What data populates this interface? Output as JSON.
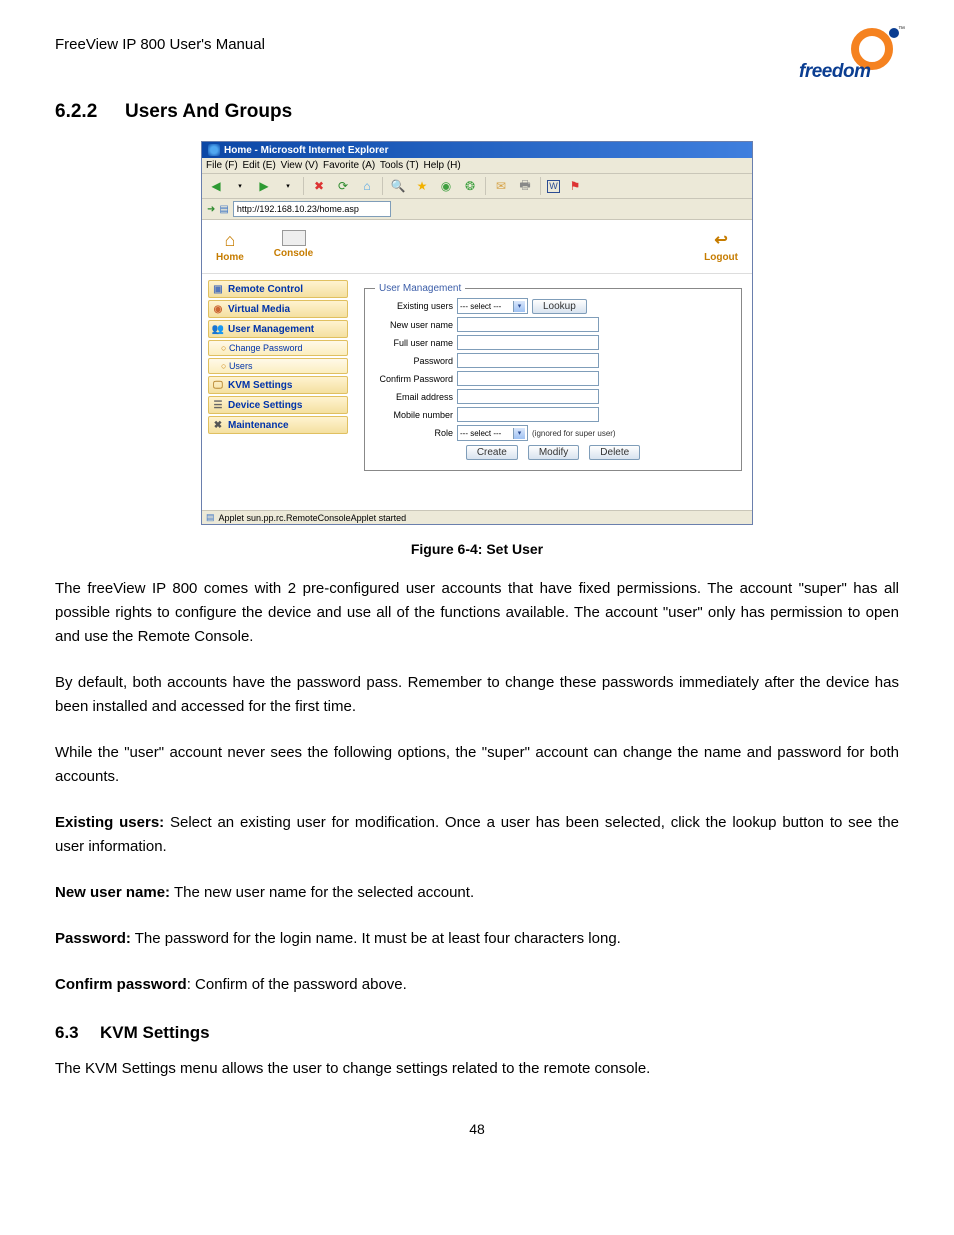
{
  "doc_header": "FreeView IP 800 User's Manual",
  "logo_text": "freedom",
  "section_622_num": "6.2.2",
  "section_622_title": "Users And Groups",
  "window_title": "Home - Microsoft Internet Explorer",
  "menus": [
    "File (F)",
    "Edit (E)",
    "View (V)",
    "Favorite (A)",
    "Tools (T)",
    "Help (H)"
  ],
  "address_url": "http://192.168.10.23/home.asp",
  "nav": {
    "home": "Home",
    "console": "Console",
    "logout": "Logout"
  },
  "sidebar": {
    "remote_control": "Remote Control",
    "virtual_media": "Virtual Media",
    "user_management": "User Management",
    "change_password": "Change Password",
    "users": "Users",
    "kvm_settings": "KVM Settings",
    "device_settings": "Device Settings",
    "maintenance": "Maintenance"
  },
  "form": {
    "legend": "User Management",
    "existing_users": "Existing users",
    "existing_select": "--- select ---",
    "lookup": "Lookup",
    "new_user": "New user name",
    "full_user": "Full user name",
    "password": "Password",
    "confirm_password": "Confirm Password",
    "email": "Email address",
    "mobile": "Mobile number",
    "role": "Role",
    "role_select": "--- select ---",
    "role_hint": "(ignored for super user)",
    "create": "Create",
    "modify": "Modify",
    "delete": "Delete"
  },
  "status_text": "Applet sun.pp.rc.RemoteConsoleApplet started",
  "figure_caption": "Figure 6-4: Set User",
  "para1": "The freeView IP 800 comes with 2 pre-configured user accounts that have fixed permissions. The account \"super\" has all possible rights to configure the device and use all of the functions available. The account \"user\" only has permission to open and use the Remote Console.",
  "para2": "By default, both accounts have the password pass. Remember to change these passwords immediately after the device has been installed and accessed for the first time.",
  "para3": "While the \"user\" account never sees the following options, the \"super\" account can change the name and password for both accounts.",
  "existing_users_label": "Existing users:",
  "existing_users_text": " Select an existing user for modification. Once a user has been selected, click the lookup button to see the user information.",
  "new_user_label": "New user name:",
  "new_user_text": " The new user name for the selected account.",
  "password_label": "Password:",
  "password_text": " The password for the login name. It must be at least four characters long.",
  "confirm_label": "Confirm password",
  "confirm_text": ": Confirm of the password above.",
  "section_63_num": "6.3",
  "section_63_title": "KVM Settings",
  "para_63": "The KVM Settings menu allows the user to change settings related to the remote console.",
  "page_number": "48"
}
